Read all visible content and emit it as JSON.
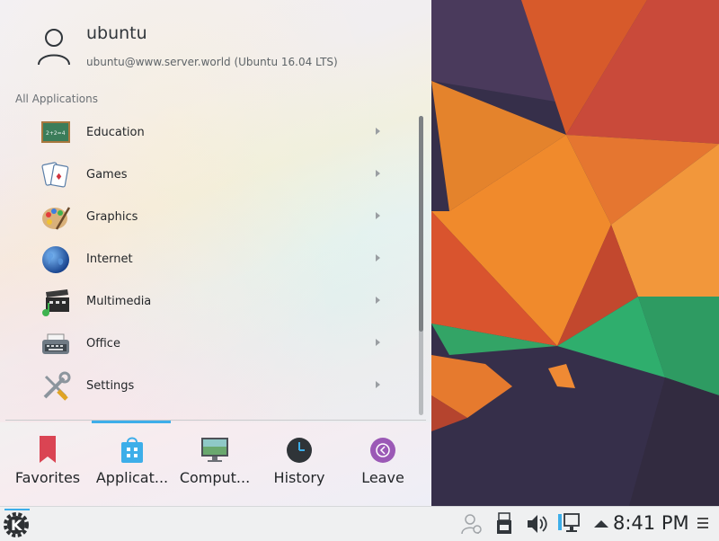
{
  "user": {
    "name": "ubuntu",
    "host": "ubuntu@www.server.world (Ubuntu 16.04 LTS)"
  },
  "section_title": "All Applications",
  "apps": [
    {
      "label": "Education",
      "icon": "education-chalkboard-icon"
    },
    {
      "label": "Games",
      "icon": "games-cards-icon"
    },
    {
      "label": "Graphics",
      "icon": "graphics-palette-icon"
    },
    {
      "label": "Internet",
      "icon": "internet-globe-icon"
    },
    {
      "label": "Multimedia",
      "icon": "multimedia-clapper-icon"
    },
    {
      "label": "Office",
      "icon": "office-typewriter-icon"
    },
    {
      "label": "Settings",
      "icon": "settings-tools-icon"
    }
  ],
  "tabs": [
    {
      "label": "Favorites",
      "icon": "bookmark-icon"
    },
    {
      "label": "Applicat...",
      "icon": "applications-bag-icon",
      "active": true
    },
    {
      "label": "Comput...",
      "icon": "computer-monitor-icon"
    },
    {
      "label": "History",
      "icon": "clock-icon"
    },
    {
      "label": "Leave",
      "icon": "leave-arrow-icon"
    }
  ],
  "panel": {
    "clock": "8:41 PM",
    "tray_icons": [
      "user-switch-icon",
      "usb-device-icon",
      "volume-icon",
      "network-icon",
      "expand-tray-icon"
    ]
  },
  "colors": {
    "accent": "#3daee9",
    "favorites_red": "#da4453",
    "leave_purple": "#9b59b6"
  }
}
